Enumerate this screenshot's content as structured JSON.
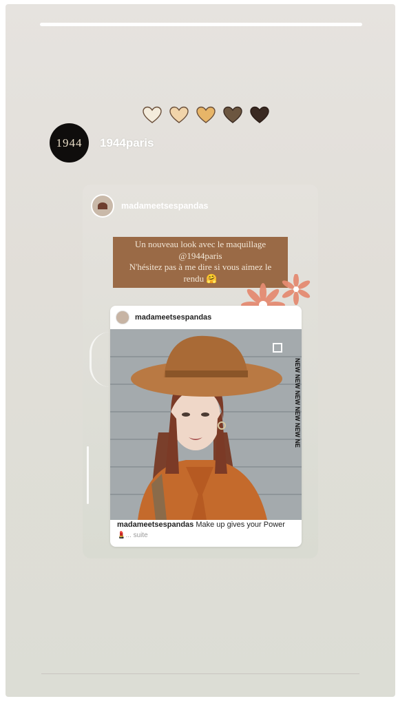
{
  "story": {
    "progress": 1.0,
    "hearts": [
      {
        "icon": "heart-icon",
        "color": "#f3ebd8"
      },
      {
        "icon": "heart-icon",
        "color": "#f0d3a9"
      },
      {
        "icon": "heart-icon",
        "color": "#e8b66b"
      },
      {
        "icon": "heart-icon",
        "color": "#6c5640"
      },
      {
        "icon": "heart-icon",
        "color": "#3a2a22"
      }
    ],
    "author": {
      "avatar_text": "1944",
      "username": "1944paris"
    }
  },
  "repost": {
    "username": "madameetsespandas",
    "caption_lines": [
      "Un nouveau look avec le maquillage",
      "@1944paris",
      "N'hésitez pas à me dire si vous aimez le",
      "rendu 🤗"
    ],
    "inner_post": {
      "username": "madameetsespandas",
      "caption_user": "madameetsespandas",
      "caption_text": " Make up gives your Power",
      "suite": "💄... suite",
      "sticker_text": "NEW NEW NEW NEW NEW NE"
    }
  },
  "colors": {
    "caption_bg": "#9a6a46",
    "flower": "#e58b72"
  }
}
